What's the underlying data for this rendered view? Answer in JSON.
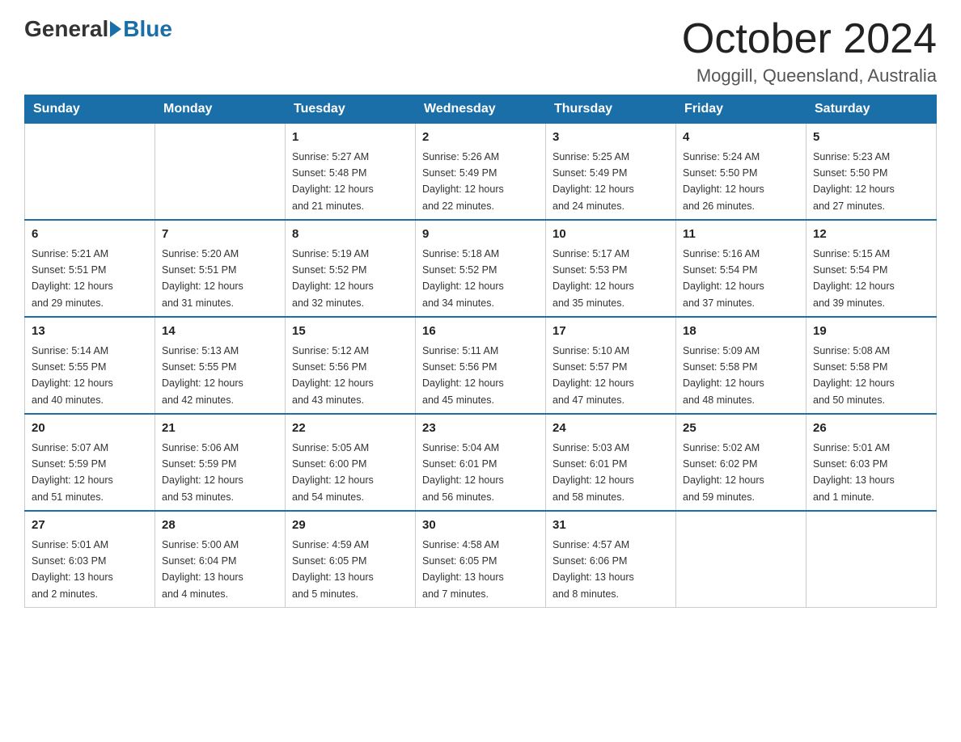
{
  "header": {
    "logo_general": "General",
    "logo_blue": "Blue",
    "month_title": "October 2024",
    "location": "Moggill, Queensland, Australia"
  },
  "days_of_week": [
    "Sunday",
    "Monday",
    "Tuesday",
    "Wednesday",
    "Thursday",
    "Friday",
    "Saturday"
  ],
  "weeks": [
    [
      {
        "day": "",
        "info": ""
      },
      {
        "day": "",
        "info": ""
      },
      {
        "day": "1",
        "info": "Sunrise: 5:27 AM\nSunset: 5:48 PM\nDaylight: 12 hours\nand 21 minutes."
      },
      {
        "day": "2",
        "info": "Sunrise: 5:26 AM\nSunset: 5:49 PM\nDaylight: 12 hours\nand 22 minutes."
      },
      {
        "day": "3",
        "info": "Sunrise: 5:25 AM\nSunset: 5:49 PM\nDaylight: 12 hours\nand 24 minutes."
      },
      {
        "day": "4",
        "info": "Sunrise: 5:24 AM\nSunset: 5:50 PM\nDaylight: 12 hours\nand 26 minutes."
      },
      {
        "day": "5",
        "info": "Sunrise: 5:23 AM\nSunset: 5:50 PM\nDaylight: 12 hours\nand 27 minutes."
      }
    ],
    [
      {
        "day": "6",
        "info": "Sunrise: 5:21 AM\nSunset: 5:51 PM\nDaylight: 12 hours\nand 29 minutes."
      },
      {
        "day": "7",
        "info": "Sunrise: 5:20 AM\nSunset: 5:51 PM\nDaylight: 12 hours\nand 31 minutes."
      },
      {
        "day": "8",
        "info": "Sunrise: 5:19 AM\nSunset: 5:52 PM\nDaylight: 12 hours\nand 32 minutes."
      },
      {
        "day": "9",
        "info": "Sunrise: 5:18 AM\nSunset: 5:52 PM\nDaylight: 12 hours\nand 34 minutes."
      },
      {
        "day": "10",
        "info": "Sunrise: 5:17 AM\nSunset: 5:53 PM\nDaylight: 12 hours\nand 35 minutes."
      },
      {
        "day": "11",
        "info": "Sunrise: 5:16 AM\nSunset: 5:54 PM\nDaylight: 12 hours\nand 37 minutes."
      },
      {
        "day": "12",
        "info": "Sunrise: 5:15 AM\nSunset: 5:54 PM\nDaylight: 12 hours\nand 39 minutes."
      }
    ],
    [
      {
        "day": "13",
        "info": "Sunrise: 5:14 AM\nSunset: 5:55 PM\nDaylight: 12 hours\nand 40 minutes."
      },
      {
        "day": "14",
        "info": "Sunrise: 5:13 AM\nSunset: 5:55 PM\nDaylight: 12 hours\nand 42 minutes."
      },
      {
        "day": "15",
        "info": "Sunrise: 5:12 AM\nSunset: 5:56 PM\nDaylight: 12 hours\nand 43 minutes."
      },
      {
        "day": "16",
        "info": "Sunrise: 5:11 AM\nSunset: 5:56 PM\nDaylight: 12 hours\nand 45 minutes."
      },
      {
        "day": "17",
        "info": "Sunrise: 5:10 AM\nSunset: 5:57 PM\nDaylight: 12 hours\nand 47 minutes."
      },
      {
        "day": "18",
        "info": "Sunrise: 5:09 AM\nSunset: 5:58 PM\nDaylight: 12 hours\nand 48 minutes."
      },
      {
        "day": "19",
        "info": "Sunrise: 5:08 AM\nSunset: 5:58 PM\nDaylight: 12 hours\nand 50 minutes."
      }
    ],
    [
      {
        "day": "20",
        "info": "Sunrise: 5:07 AM\nSunset: 5:59 PM\nDaylight: 12 hours\nand 51 minutes."
      },
      {
        "day": "21",
        "info": "Sunrise: 5:06 AM\nSunset: 5:59 PM\nDaylight: 12 hours\nand 53 minutes."
      },
      {
        "day": "22",
        "info": "Sunrise: 5:05 AM\nSunset: 6:00 PM\nDaylight: 12 hours\nand 54 minutes."
      },
      {
        "day": "23",
        "info": "Sunrise: 5:04 AM\nSunset: 6:01 PM\nDaylight: 12 hours\nand 56 minutes."
      },
      {
        "day": "24",
        "info": "Sunrise: 5:03 AM\nSunset: 6:01 PM\nDaylight: 12 hours\nand 58 minutes."
      },
      {
        "day": "25",
        "info": "Sunrise: 5:02 AM\nSunset: 6:02 PM\nDaylight: 12 hours\nand 59 minutes."
      },
      {
        "day": "26",
        "info": "Sunrise: 5:01 AM\nSunset: 6:03 PM\nDaylight: 13 hours\nand 1 minute."
      }
    ],
    [
      {
        "day": "27",
        "info": "Sunrise: 5:01 AM\nSunset: 6:03 PM\nDaylight: 13 hours\nand 2 minutes."
      },
      {
        "day": "28",
        "info": "Sunrise: 5:00 AM\nSunset: 6:04 PM\nDaylight: 13 hours\nand 4 minutes."
      },
      {
        "day": "29",
        "info": "Sunrise: 4:59 AM\nSunset: 6:05 PM\nDaylight: 13 hours\nand 5 minutes."
      },
      {
        "day": "30",
        "info": "Sunrise: 4:58 AM\nSunset: 6:05 PM\nDaylight: 13 hours\nand 7 minutes."
      },
      {
        "day": "31",
        "info": "Sunrise: 4:57 AM\nSunset: 6:06 PM\nDaylight: 13 hours\nand 8 minutes."
      },
      {
        "day": "",
        "info": ""
      },
      {
        "day": "",
        "info": ""
      }
    ]
  ]
}
